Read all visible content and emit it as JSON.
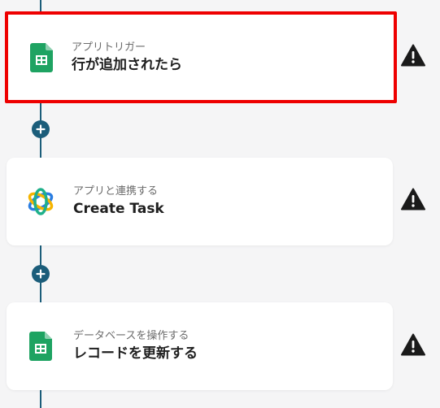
{
  "flow": {
    "steps": [
      {
        "subtitle": "アプリトリガー",
        "title": "行が追加されたら",
        "icon": "google-sheets-icon",
        "selected": true,
        "warning_icon": "warning-icon"
      },
      {
        "subtitle": "アプリと連携する",
        "title": "Create Task",
        "icon": "task-app-logo-icon",
        "selected": false,
        "warning_icon": "warning-icon"
      },
      {
        "subtitle": "データベースを操作する",
        "title": "レコードを更新する",
        "icon": "google-sheets-icon",
        "selected": false,
        "warning_icon": "warning-icon"
      }
    ],
    "add_step_icon": "plus-icon"
  },
  "colors": {
    "background": "#f5f5f6",
    "flow_line": "#1b5d7a",
    "selected_border": "#ee0000",
    "sheets_green": "#1ea362",
    "warning": "#1a1a1a"
  }
}
